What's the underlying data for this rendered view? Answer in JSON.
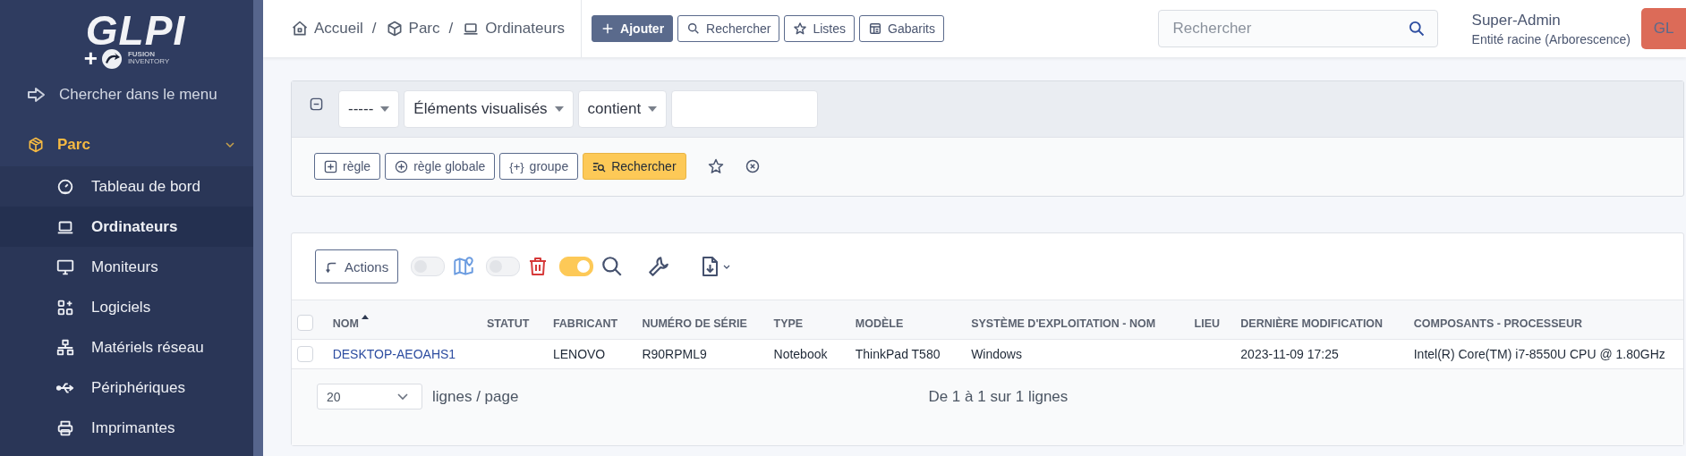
{
  "logo": {
    "title": "GLPI",
    "plus": "+",
    "brand_1": "FUSION",
    "brand_2": "INVENTORY"
  },
  "sidebar": {
    "search_label": "Chercher dans le menu",
    "section": {
      "label": "Parc",
      "expanded": true
    },
    "items": [
      {
        "label": "Tableau de bord",
        "kind": "gauge",
        "selected": false
      },
      {
        "label": "Ordinateurs",
        "kind": "laptop",
        "selected": true
      },
      {
        "label": "Moniteurs",
        "kind": "monitor",
        "selected": false
      },
      {
        "label": "Logiciels",
        "kind": "apps",
        "selected": false
      },
      {
        "label": "Matériels réseau",
        "kind": "network",
        "selected": false
      },
      {
        "label": "Périphériques",
        "kind": "usb",
        "selected": false
      },
      {
        "label": "Imprimantes",
        "kind": "printer",
        "selected": false
      }
    ]
  },
  "breadcrumb": [
    {
      "label": "Accueil",
      "kind": "home"
    },
    {
      "label": "Parc",
      "kind": "box"
    },
    {
      "label": "Ordinateurs",
      "kind": "laptop"
    }
  ],
  "breadcrumb_separators": [
    "/",
    "/"
  ],
  "header_buttons": [
    {
      "label": "Ajouter",
      "kind": "add",
      "primary": true
    },
    {
      "label": "Rechercher",
      "kind": "search",
      "primary": false
    },
    {
      "label": "Listes",
      "kind": "star",
      "primary": false
    },
    {
      "label": "Gabarits",
      "kind": "template",
      "primary": false
    }
  ],
  "search": {
    "placeholder": "Rechercher"
  },
  "user": {
    "name": "Super-Admin",
    "entity": "Entité racine (Arborescence)",
    "initials": "GL"
  },
  "criteria": {
    "field": "-----",
    "item": "Éléments visualisés",
    "operator": "contient"
  },
  "criteria_buttons": [
    {
      "label": "règle",
      "kind": "rule",
      "primary": false
    },
    {
      "label": "règle globale",
      "kind": "global",
      "primary": false
    },
    {
      "label": "groupe",
      "kind": "group",
      "icon_text": "{+}",
      "primary": false
    },
    {
      "label": "Rechercher",
      "kind": "search",
      "primary": true
    }
  ],
  "toolbar": {
    "actions": "Actions",
    "toggles": [
      {
        "kind": "map",
        "on": false
      },
      {
        "kind": "trash",
        "on": false
      },
      {
        "kind": "search",
        "on": true
      }
    ]
  },
  "table": {
    "columns": [
      {
        "label": "NOM",
        "sorted": true
      },
      {
        "label": "STATUT",
        "sorted": false
      },
      {
        "label": "FABRICANT",
        "sorted": false
      },
      {
        "label": "NUMÉRO DE SÉRIE",
        "sorted": false
      },
      {
        "label": "TYPE",
        "sorted": false
      },
      {
        "label": "MODÈLE",
        "sorted": false
      },
      {
        "label": "SYSTÈME D'EXPLOITATION - NOM",
        "sorted": false
      },
      {
        "label": "LIEU",
        "sorted": false
      },
      {
        "label": "DERNIÈRE MODIFICATION",
        "sorted": false
      },
      {
        "label": "COMPOSANTS - PROCESSEUR",
        "sorted": false
      }
    ],
    "all_selected": false,
    "rows": [
      {
        "selected": false,
        "cells": [
          "DESKTOP-AEOAHS1",
          null,
          "LENOVO",
          "R90RPML9",
          "Notebook",
          "ThinkPad T580",
          "Windows",
          null,
          "2023-11-09 17:25",
          "Intel(R) Core(TM) i7-8550U CPU @ 1.80GHz"
        ]
      }
    ]
  },
  "pagination": {
    "page_size": "20",
    "label": "lignes / page",
    "summary": "De 1 à 1 sur 1 lignes"
  }
}
